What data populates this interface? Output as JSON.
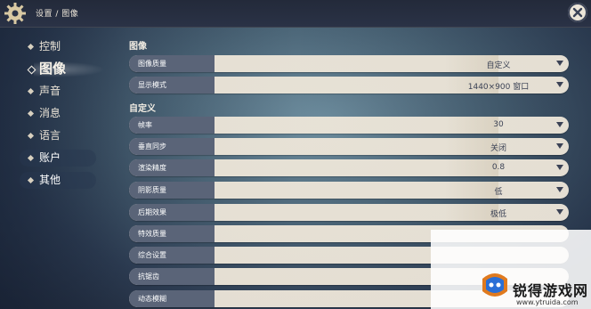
{
  "header": {
    "breadcrumb": "设置 / 图像",
    "settings_icon": "gear-icon",
    "close_icon": "close-icon"
  },
  "sidebar": {
    "items": [
      {
        "label": "控制"
      },
      {
        "label": "图像",
        "active": true
      },
      {
        "label": "声音"
      },
      {
        "label": "消息"
      },
      {
        "label": "语言"
      },
      {
        "label": "账户"
      },
      {
        "label": "其他"
      }
    ]
  },
  "main": {
    "section1_title": "图像",
    "section2_title": "自定义",
    "rows": [
      {
        "label": "图像质量",
        "value": "自定义",
        "dropdown": true
      },
      {
        "label": "显示模式",
        "value": "1440×900 窗口",
        "dropdown": true
      },
      {
        "label": "帧率",
        "value": "30",
        "dropdown": true
      },
      {
        "label": "垂直同步",
        "value": "关闭",
        "dropdown": true
      },
      {
        "label": "渲染精度",
        "value": "0.8",
        "dropdown": true
      },
      {
        "label": "阴影质量",
        "value": "低",
        "dropdown": true
      },
      {
        "label": "后期效果",
        "value": "极低",
        "dropdown": true
      },
      {
        "label": "特效质量",
        "value": ""
      },
      {
        "label": "综合设置",
        "value": ""
      },
      {
        "label": "抗锯齿",
        "value": ""
      },
      {
        "label": "动态模糊",
        "value": ""
      }
    ]
  },
  "watermark": {
    "title": "锐得游戏网",
    "url": "www.ytruida.com"
  },
  "colors": {
    "panel_row": "#ece5d8",
    "label_bg": "#5a6478",
    "text_dark": "#3b4255"
  }
}
